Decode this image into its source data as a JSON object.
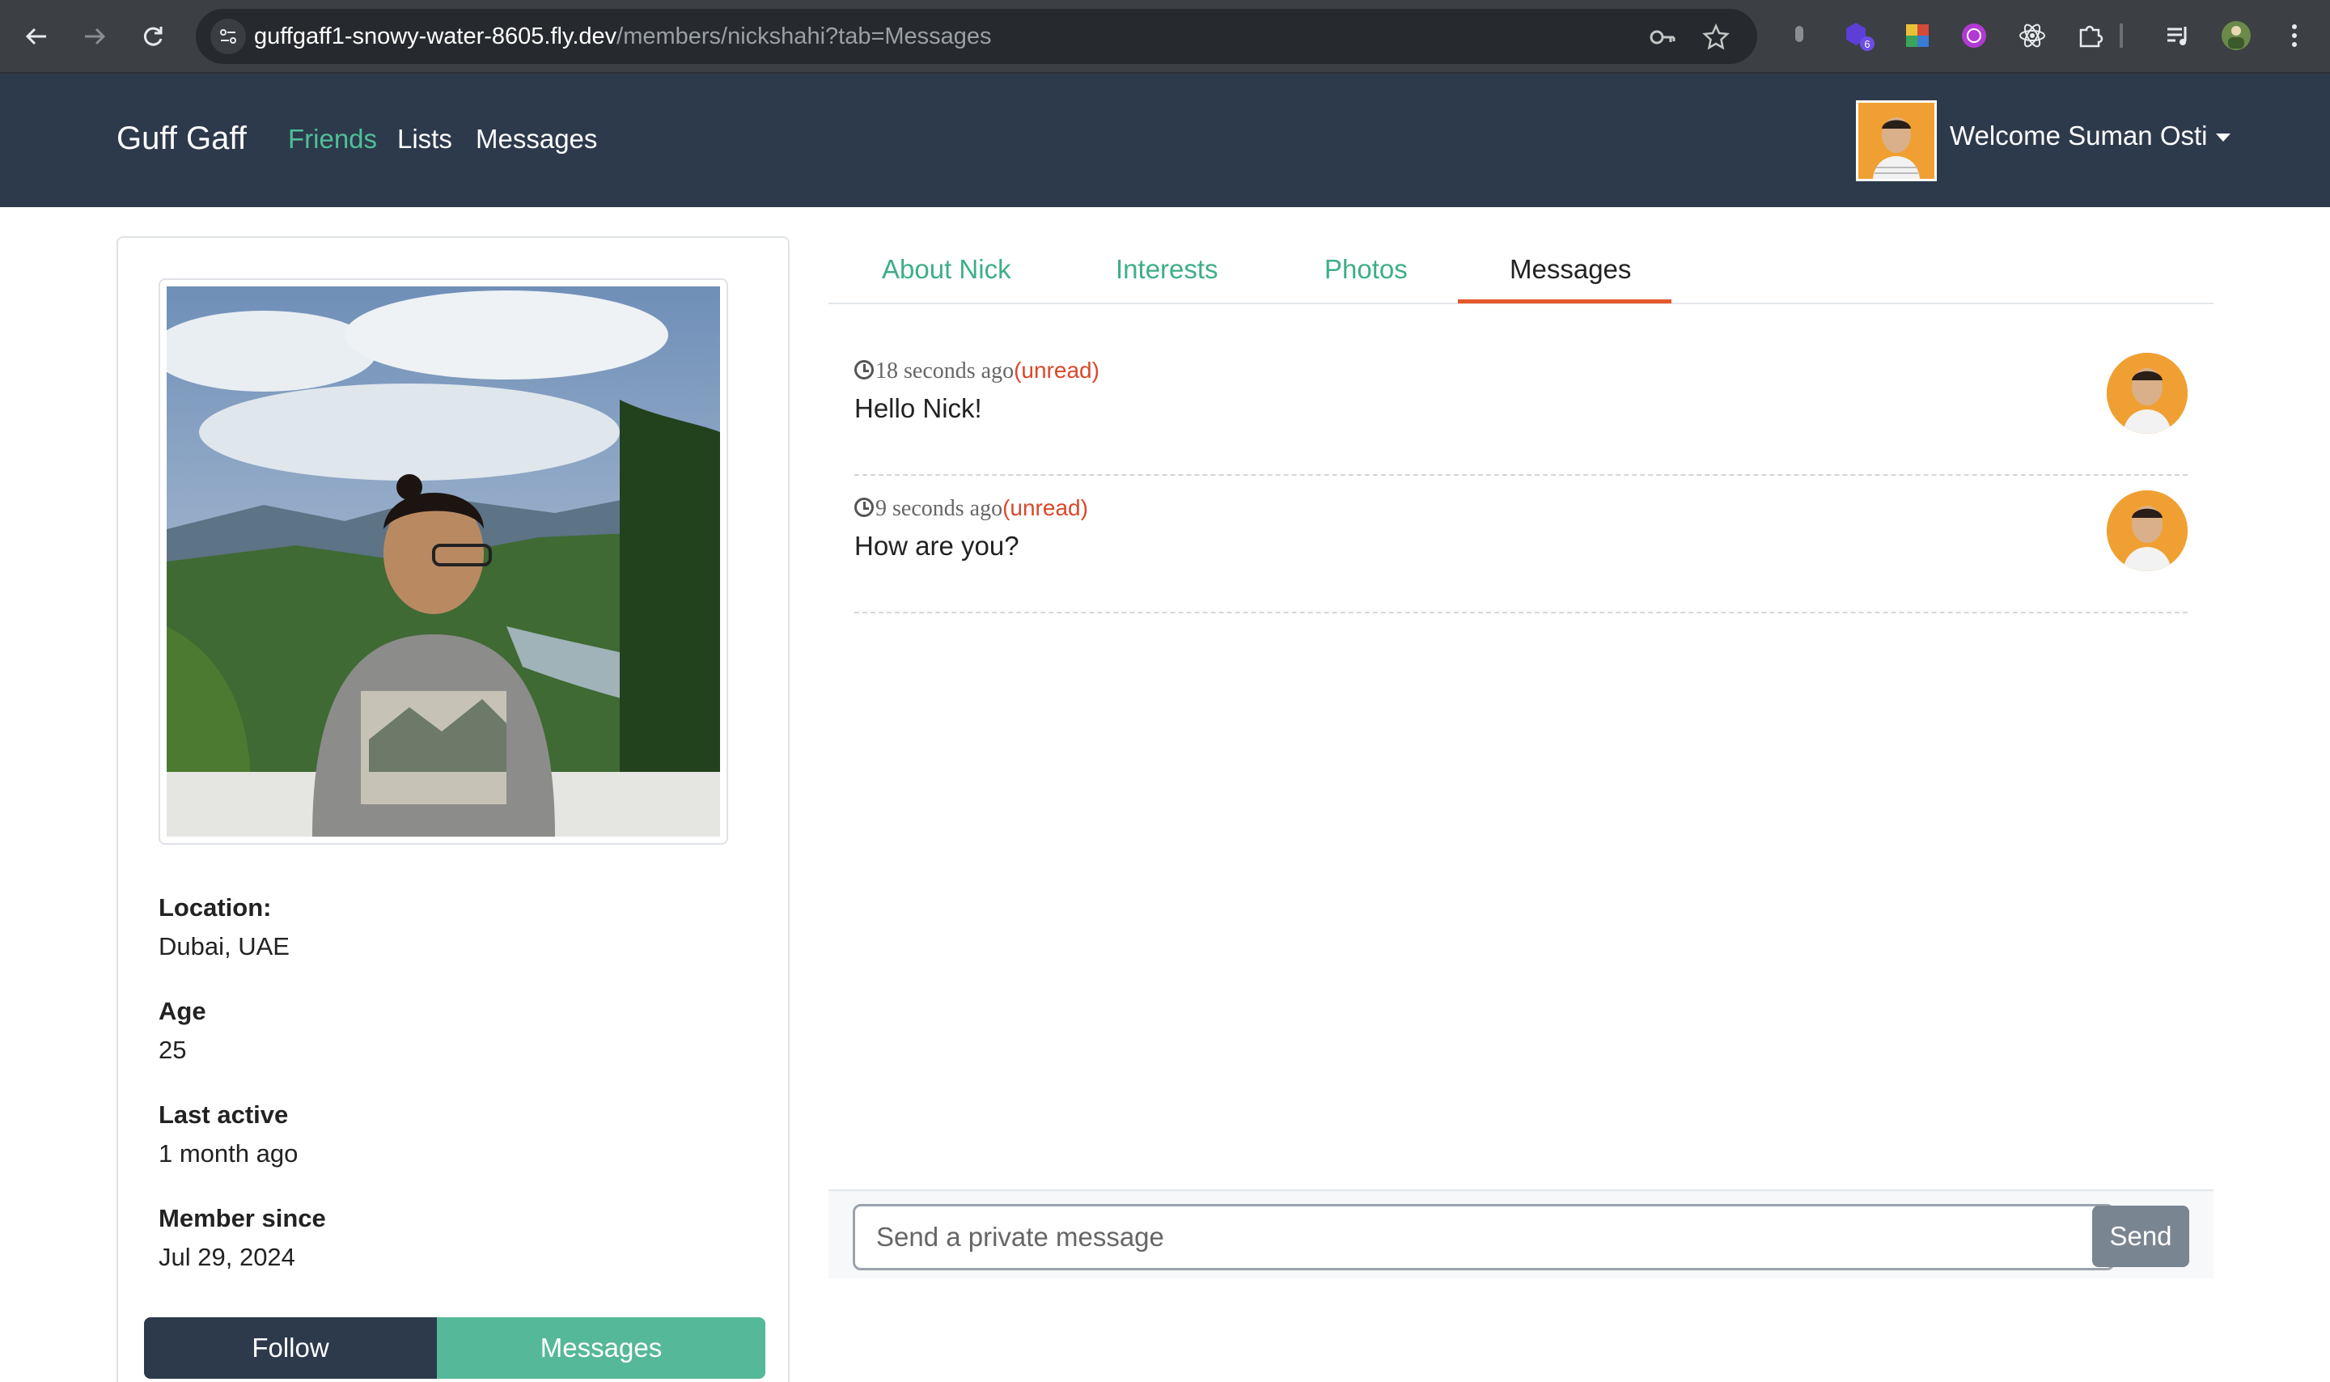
{
  "browser": {
    "url_host": "guffgaff1-snowy-water-8605.fly.dev",
    "url_path": "/members/nickshahi?tab=Messages",
    "extension_badge": "6",
    "icons": [
      "back-icon",
      "forward-icon",
      "reload-icon",
      "site-info-icon",
      "password-key-icon",
      "bookmark-star-icon",
      "extensions-puzzle-icon",
      "reading-list-icon",
      "profile-icon",
      "more-menu-icon"
    ]
  },
  "navbar": {
    "brand": "Guff Gaff",
    "links": [
      "Friends",
      "Lists",
      "Messages"
    ],
    "active_link": "Friends",
    "welcome": "Welcome Suman Osti"
  },
  "profile": {
    "location_label": "Location:",
    "location_value": "Dubai, UAE",
    "age_label": "Age",
    "age_value": "25",
    "last_active_label": "Last active",
    "last_active_value": "1 month ago",
    "member_since_label": "Member since",
    "member_since_value": "Jul 29, 2024",
    "follow_label": "Follow",
    "messages_label": "Messages"
  },
  "tabs": {
    "items": [
      "About Nick",
      "Interests",
      "Photos",
      "Messages"
    ],
    "active": "Messages"
  },
  "messages": [
    {
      "time": "18 seconds ago",
      "status": "(unread)",
      "text": "Hello Nick!"
    },
    {
      "time": "9 seconds ago",
      "status": "(unread)",
      "text": "How are you?"
    }
  ],
  "composer": {
    "placeholder": "Send a private message",
    "send_label": "Send"
  },
  "colors": {
    "navbar_bg": "#2d3a4c",
    "accent_green": "#4fbf98",
    "active_tab_underline": "#e3592b",
    "unread_red": "#d9482b"
  }
}
